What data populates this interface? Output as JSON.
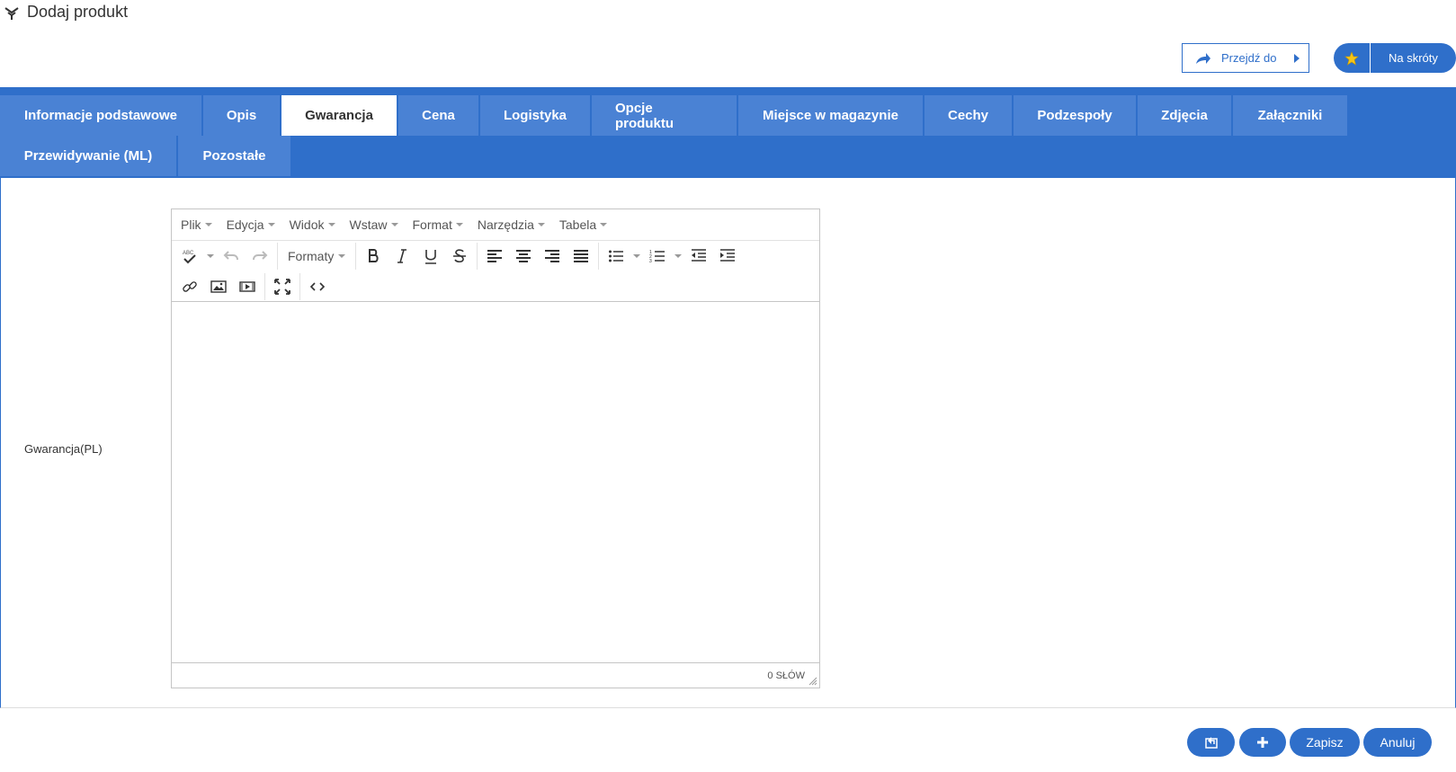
{
  "header": {
    "title": "Dodaj produkt",
    "goto_label": "Przejdź do",
    "shortcuts_label": "Na skróty"
  },
  "tabs": {
    "row1": [
      "Informacje podstawowe",
      "Opis",
      "Gwarancja",
      "Cena",
      "Logistyka",
      "Opcje produktu",
      "Miejsce w magazynie",
      "Cechy",
      "Podzespoły",
      "Zdjęcia",
      "Załączniki"
    ],
    "row2": [
      "Przewidywanie (ML)",
      "Pozostałe"
    ],
    "active": "Gwarancja"
  },
  "form": {
    "field_label": "Gwarancja(PL)"
  },
  "editor": {
    "menu": [
      "Plik",
      "Edycja",
      "Widok",
      "Wstaw",
      "Format",
      "Narzędzia",
      "Tabela"
    ],
    "formats_label": "Formaty",
    "word_count": "0 SŁÓW"
  },
  "footer": {
    "save_label": "Zapisz",
    "cancel_label": "Anuluj"
  },
  "colors": {
    "primary": "#2f6fca",
    "tab": "#4a82d4"
  }
}
